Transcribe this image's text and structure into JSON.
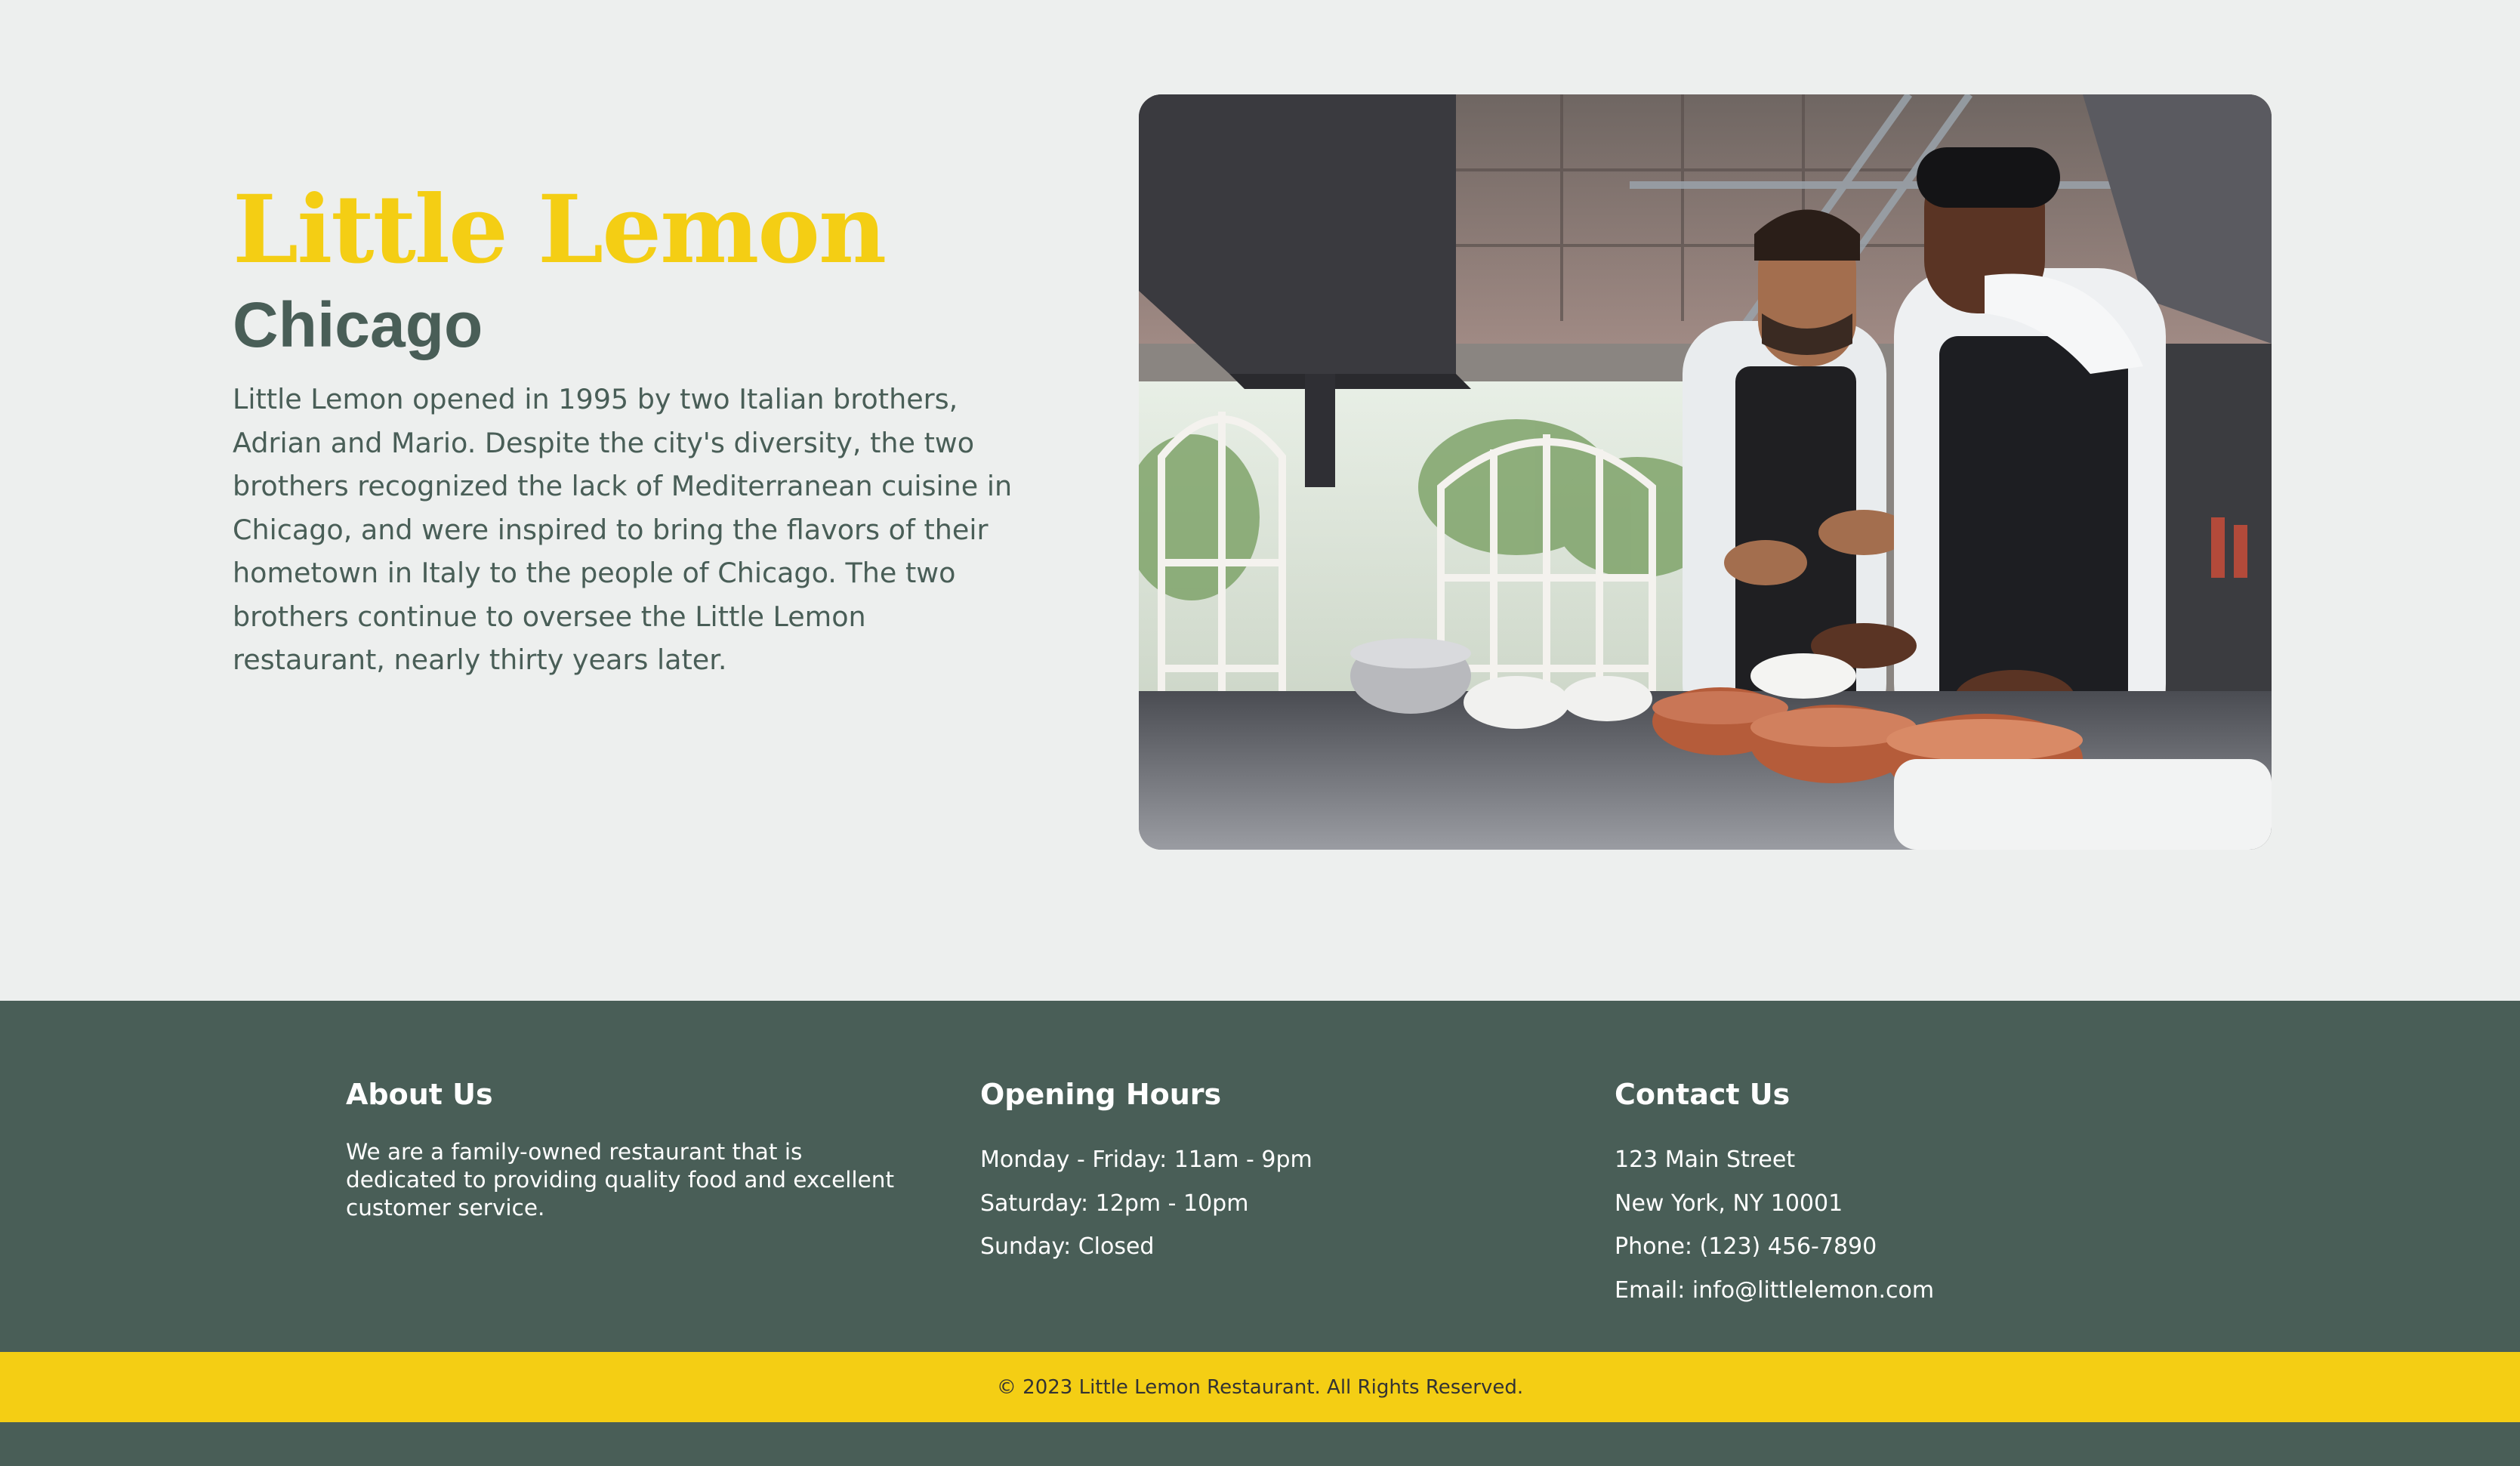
{
  "about": {
    "title": "Little Lemon",
    "subtitle": "Chicago",
    "description": "Little Lemon opened in 1995 by two Italian brothers, Adrian and Mario. Despite the city's diversity, the two brothers recognized the lack of Mediterranean cuisine in Chicago, and were inspired to bring the flavors of their hometown in Italy to the people of Chicago. The two brothers continue to oversee the Little Lemon restaurant, nearly thirty years later.",
    "photo_icon": "restaurant-kitchen-photo"
  },
  "footer": {
    "about": {
      "heading": "About Us",
      "text": "We are a family-owned restaurant that is dedicated to providing quality food and excellent customer service."
    },
    "hours": {
      "heading": "Opening Hours",
      "lines": [
        "Monday - Friday: 11am - 9pm",
        "Saturday: 12pm - 10pm",
        "Sunday: Closed"
      ]
    },
    "contact": {
      "heading": "Contact Us",
      "lines": [
        "123 Main Street",
        "New York, NY 10001",
        "Phone: (123) 456-7890",
        "Email: info@littlelemon.com"
      ]
    },
    "copyright": "© 2023 Little Lemon Restaurant. All Rights Reserved."
  },
  "colors": {
    "primary_green": "#495E57",
    "primary_yellow": "#F4CE14",
    "background": "#EDEFEE",
    "text_dark": "#333333"
  }
}
